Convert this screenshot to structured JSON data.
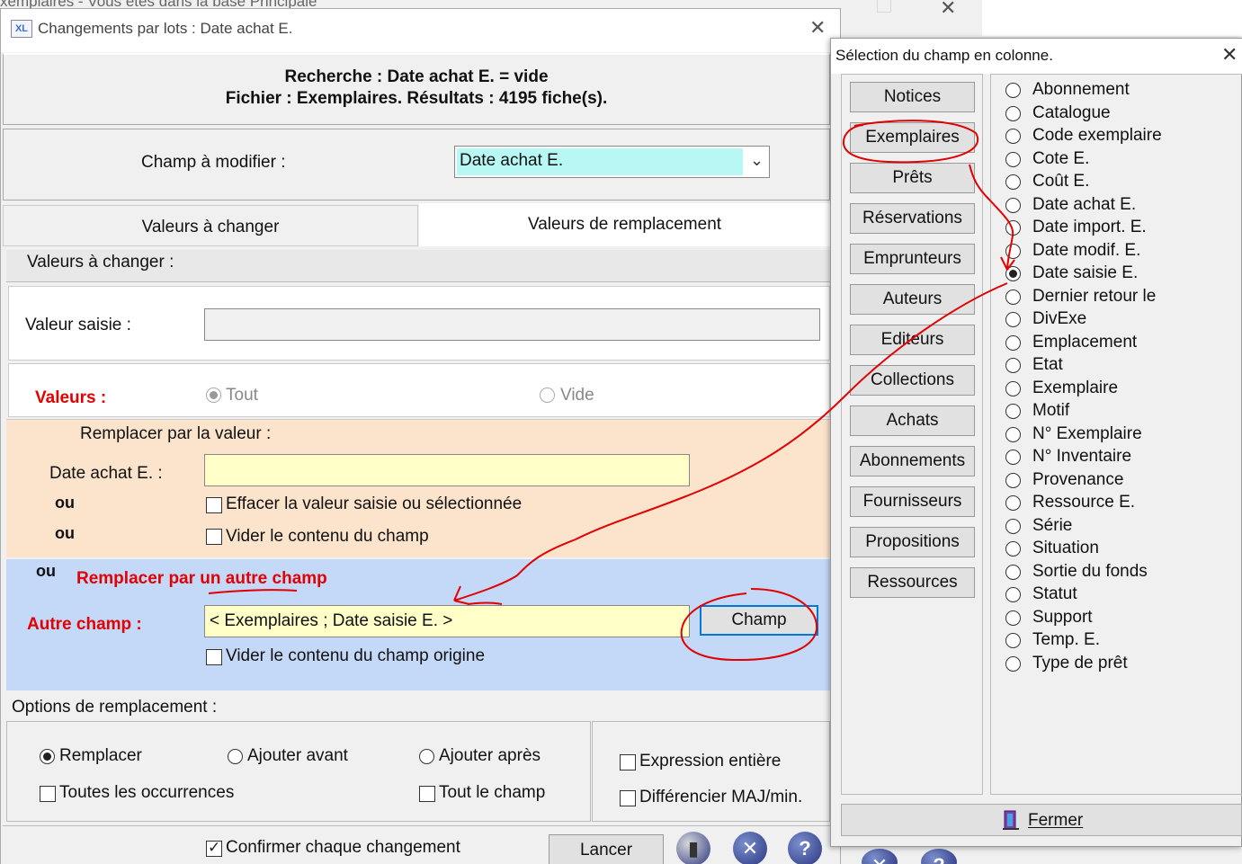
{
  "background_window": {
    "title": "xemplaires - Vous êtes dans la base Principale"
  },
  "dialog": {
    "title": "Changements par lots : Date achat E.",
    "search_line1": "Recherche : Date achat E. = vide",
    "search_line2": "Fichier : Exemplaires. Résultats : 4195 fiche(s).",
    "champ_label": "Champ à modifier :",
    "champ_value": "Date achat E.",
    "tabs": [
      "Valeurs à changer",
      "Valeurs de remplacement"
    ],
    "active_tab": 1,
    "vac_header": "Valeurs à changer :",
    "valeur_saisie_label": "Valeur saisie :",
    "valeurs_label": "Valeurs :",
    "radio_tout": "Tout",
    "radio_vide": "Vide",
    "remplacer_title": "Remplacer par la valeur :",
    "date_achat_label": "Date achat E. :",
    "ou": "ou",
    "effacer_label": "Effacer la valeur saisie ou sélectionnée",
    "vider_label": "Vider le contenu du champ",
    "autre_title": "Remplacer par un autre champ",
    "autre_label": "Autre champ :",
    "autre_value": "< Exemplaires ; Date saisie E. >",
    "champ_button": "Champ",
    "vider_origine_label": "Vider le contenu du champ origine",
    "options_label": "Options de remplacement :",
    "opt_remplacer": "Remplacer",
    "opt_avant": "Ajouter avant",
    "opt_apres": "Ajouter après",
    "opt_toutes": "Toutes les occurrences",
    "opt_tout_champ": "Tout le champ",
    "opt_expression": "Expression entière",
    "opt_differencier": "Différencier MAJ/min.",
    "confirmer_label": "Confirmer chaque changement",
    "lancer_button": "Lancer"
  },
  "popup": {
    "title": "Sélection du champ en colonne.",
    "categories": [
      "Notices",
      "Exemplaires",
      "Prêts",
      "Réservations",
      "Emprunteurs",
      "Auteurs",
      "Editeurs",
      "Collections",
      "Achats",
      "Abonnements",
      "Fournisseurs",
      "Propositions",
      "Ressources"
    ],
    "fields": [
      "Abonnement",
      "Catalogue",
      "Code exemplaire",
      "Cote E.",
      "Coût E.",
      "Date achat E.",
      "Date import. E.",
      "Date modif. E.",
      "Date saisie E.",
      "Dernier retour le",
      "DivExe",
      "Emplacement",
      "Etat",
      "Exemplaire",
      "Motif",
      "N° Exemplaire",
      "N° Inventaire",
      "Provenance",
      "Ressource E.",
      "Série",
      "Situation",
      "Sortie du fonds",
      "Statut",
      "Support",
      "Temp. E.",
      "Type de prêt"
    ],
    "selected_field": "Date saisie E.",
    "fermer_label": "Fermer"
  },
  "colors": {
    "accent": "#0078d7",
    "annotation": "#e00000",
    "cyan_field": "#b8f8f4",
    "yellow_field": "#ffffc8",
    "peach_section": "#fbe3cc",
    "blue_section": "#c4d8f8"
  }
}
